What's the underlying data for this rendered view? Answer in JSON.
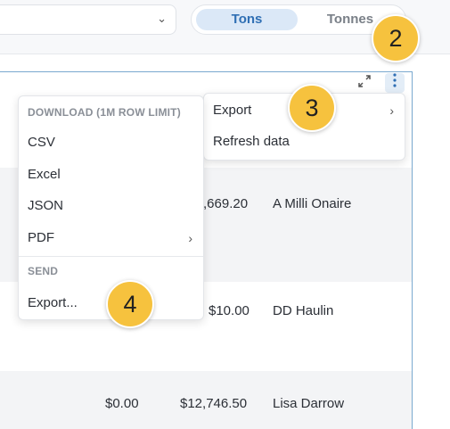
{
  "topbar": {
    "unit_toggle": {
      "active": "Tons",
      "inactive": "Tonnes"
    }
  },
  "panel": {
    "expand_icon": "expand-icon",
    "more_icon": "vertical-dots-icon"
  },
  "table": {
    "rows": [
      {
        "amount": ",669.20",
        "name": "A Milli Onaire"
      },
      {
        "amount": "$10.00",
        "name": "DD Haulin"
      },
      {
        "amount_a": "$0.00",
        "amount_b": "$12,746.50",
        "name": "Lisa Darrow"
      }
    ]
  },
  "download_menu": {
    "header_download": "DOWNLOAD (1M ROW LIMIT)",
    "items": [
      "CSV",
      "Excel",
      "JSON",
      "PDF"
    ],
    "header_send": "SEND",
    "send_items": [
      "Export..."
    ]
  },
  "more_menu": {
    "items": [
      "Export",
      "Refresh data"
    ]
  },
  "callouts": [
    "2",
    "3",
    "4"
  ],
  "colors": {
    "accent": "#2f6fb4",
    "callout": "#f6c23e"
  }
}
